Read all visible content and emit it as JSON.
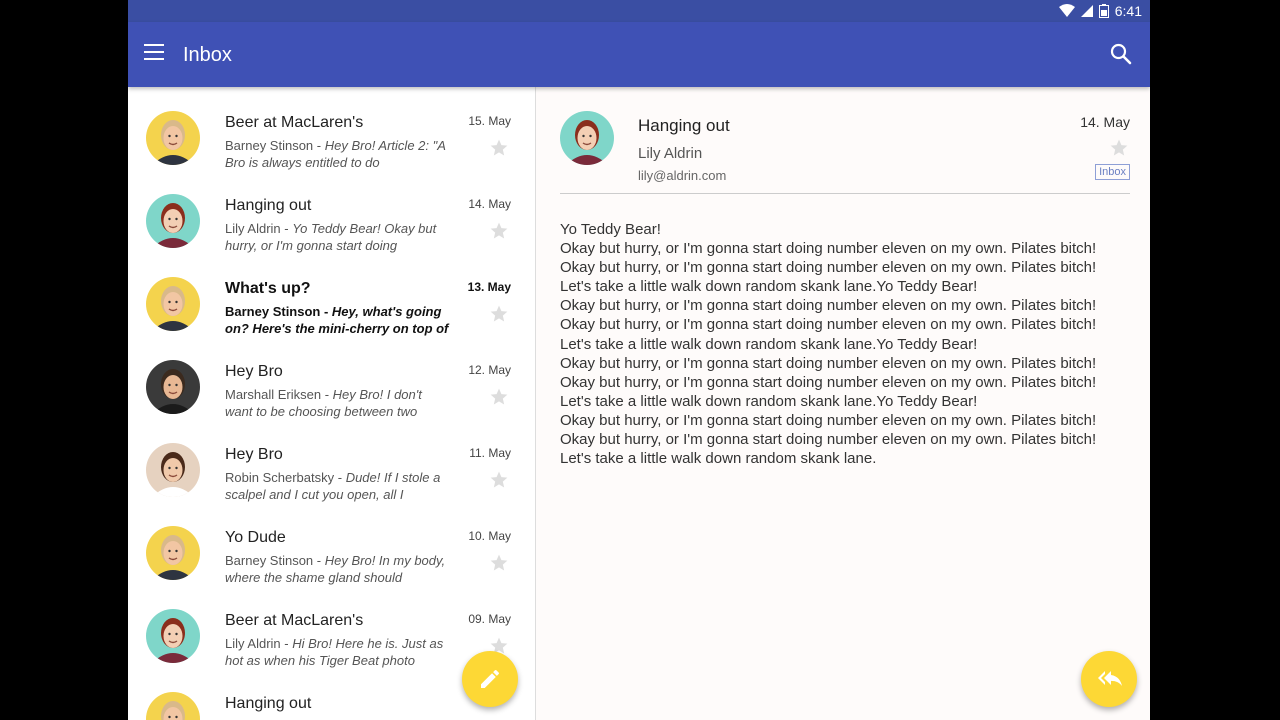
{
  "statusbar": {
    "time": "6:41"
  },
  "appbar": {
    "title": "Inbox"
  },
  "colors": {
    "primary": "#3f51b5",
    "accent": "#fdd835"
  },
  "emails": [
    {
      "subject": "Beer at MacLaren's",
      "sender": "Barney Stinson",
      "snippet": "Hey Bro! Article 2: \"A Bro is always entitled to do",
      "date": "15. May",
      "unread": false,
      "avatar": "barney"
    },
    {
      "subject": "Hanging out",
      "sender": "Lily Aldrin",
      "snippet": "Yo Teddy Bear! Okay but hurry, or I'm gonna start doing",
      "date": "14. May",
      "unread": false,
      "avatar": "lily"
    },
    {
      "subject": "What's up?",
      "sender": "Barney Stinson",
      "snippet": "Hey, what's going on? Here's the mini-cherry on top of",
      "date": "13. May",
      "unread": true,
      "avatar": "barney"
    },
    {
      "subject": "Hey Bro",
      "sender": "Marshall Eriksen",
      "snippet": "Hey Bro! I don't want to be choosing between two",
      "date": "12. May",
      "unread": false,
      "avatar": "marshall"
    },
    {
      "subject": "Hey Bro",
      "sender": "Robin Scherbatsky",
      "snippet": "Dude! If I stole a scalpel and I cut you open, all I",
      "date": "11. May",
      "unread": false,
      "avatar": "robin"
    },
    {
      "subject": "Yo Dude",
      "sender": "Barney Stinson",
      "snippet": "Hey Bro! In my body, where the shame gland should",
      "date": "10. May",
      "unread": false,
      "avatar": "barney"
    },
    {
      "subject": "Beer at MacLaren's",
      "sender": "Lily Aldrin",
      "snippet": "Hi Bro! Here he is. Just as hot as when his Tiger Beat photo",
      "date": "09. May",
      "unread": false,
      "avatar": "lily"
    },
    {
      "subject": "Hanging out",
      "sender": "",
      "snippet": "",
      "date": "",
      "unread": false,
      "avatar": "barney"
    }
  ],
  "detail": {
    "subject": "Hanging out",
    "from_name": "Lily Aldrin",
    "from_email": "lily@aldrin.com",
    "date": "14. May",
    "label": "Inbox",
    "body": [
      "Yo Teddy Bear!",
      "Okay but hurry, or I'm gonna start doing number eleven on my own. Pilates bitch!",
      "Okay but hurry, or I'm gonna start doing number eleven on my own. Pilates bitch!",
      "Let's take a little walk down random skank lane.Yo Teddy Bear!",
      "Okay but hurry, or I'm gonna start doing number eleven on my own. Pilates bitch!",
      "Okay but hurry, or I'm gonna start doing number eleven on my own. Pilates bitch!",
      "Let's take a little walk down random skank lane.Yo Teddy Bear!",
      "Okay but hurry, or I'm gonna start doing number eleven on my own. Pilates bitch!",
      "Okay but hurry, or I'm gonna start doing number eleven on my own. Pilates bitch!",
      "Let's take a little walk down random skank lane.Yo Teddy Bear!",
      "Okay but hurry, or I'm gonna start doing number eleven on my own. Pilates bitch!",
      "Okay but hurry, or I'm gonna start doing number eleven on my own. Pilates bitch!",
      "Let's take a little walk down random skank lane."
    ]
  },
  "icons": {
    "menu": "menu-icon",
    "search": "search-icon",
    "star": "star-outline-icon",
    "compose": "pencil-icon",
    "reply_all": "reply-all-icon"
  }
}
